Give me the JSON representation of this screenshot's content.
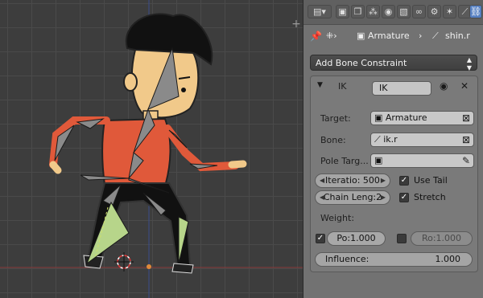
{
  "toolbar": {
    "icons": [
      "render-layers-icon",
      "scene-icon",
      "world-icon",
      "object-icon",
      "constraints-icon",
      "modifiers-icon",
      "data-icon",
      "bone-icon",
      "bone-constraints-icon"
    ]
  },
  "breadcrumb": {
    "armature": "Armature",
    "bone": "shin.r"
  },
  "add_constraint": {
    "label": "Add Bone Constraint"
  },
  "constraint": {
    "type": "IK",
    "name": "IK",
    "target_label": "Target:",
    "target_value": "Armature",
    "bone_label": "Bone:",
    "bone_value": "ik.r",
    "pole_label": "Pole Targ...",
    "iterations": "Iteratio: 500",
    "use_tail_label": "Use Tail",
    "use_tail": true,
    "chain_length": "Chain Leng:2",
    "stretch_label": "Stretch",
    "stretch": true,
    "weight_label": "Weight:",
    "weight_position": "Po:1.000",
    "weight_rotation": "Ro:1.000",
    "influence_label": "Influence:",
    "influence_value": "1.000"
  },
  "colors": {
    "active_tab": "#5680c2",
    "shirt": "#e0593a",
    "selected_bone": "#b7d58a"
  }
}
